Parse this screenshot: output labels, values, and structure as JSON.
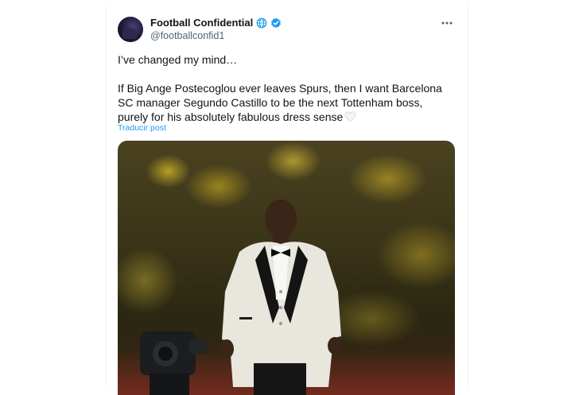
{
  "tweet": {
    "display_name": "Football Confidential",
    "handle": "@footballconfid1",
    "paragraph_1": "I’ve changed my mind…",
    "paragraph_2": "If Big Ange Postecoglou ever leaves Spurs, then I want Barcelona SC manager Segundo Castillo to be the next Tottenham boss, purely for his absolutely fabulous dress sense",
    "translate_label": "Traducir post"
  },
  "icons": {
    "avatar": "avatar",
    "globe": "globe-icon",
    "verified": "verified-badge-icon",
    "more": "more-options-icon",
    "heart": "white-heart-icon"
  },
  "colors": {
    "link": "#1d9bf0",
    "verified": "#1d9bf0",
    "secondary_text": "#536471"
  }
}
